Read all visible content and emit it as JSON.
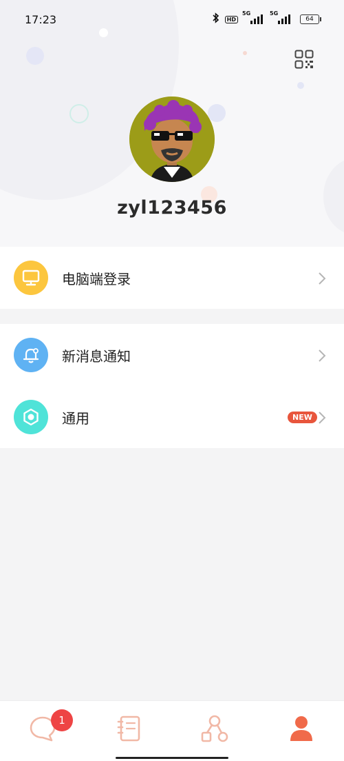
{
  "status_bar": {
    "time": "17:23",
    "hd": "HD",
    "sim1": "5G",
    "sim2": "5G",
    "battery": "64"
  },
  "profile": {
    "username": "zyl123456"
  },
  "menu": {
    "pc_login": "电脑端登录",
    "notifications": "新消息通知",
    "general": "通用",
    "general_badge": "NEW"
  },
  "tabbar": {
    "messages_badge": "1"
  },
  "colors": {
    "accent": "#f06a4a",
    "pc_icon_bg": "#fcc63e",
    "bell_icon_bg": "#5fb2f3",
    "gear_icon_bg": "#4fe3d8"
  }
}
